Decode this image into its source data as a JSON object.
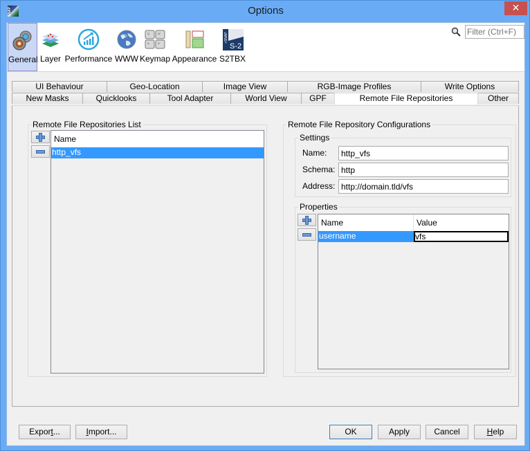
{
  "window": {
    "title": "Options",
    "app_icon_text": "SNAP",
    "close_glyph": "✕"
  },
  "toolbar": {
    "categories": [
      {
        "id": "general",
        "label": "General",
        "icon": "gears-icon",
        "selected": true
      },
      {
        "id": "layer",
        "label": "Layer",
        "icon": "layers-icon",
        "selected": false
      },
      {
        "id": "performance",
        "label": "Performance",
        "icon": "performance-chart-icon",
        "selected": false
      },
      {
        "id": "www",
        "label": "WWW",
        "icon": "globe-icon",
        "selected": false
      },
      {
        "id": "keymap",
        "label": "Keymap",
        "icon": "keyboard-keys-icon",
        "selected": false
      },
      {
        "id": "appearance",
        "label": "Appearance",
        "icon": "appearance-layout-icon",
        "selected": false
      },
      {
        "id": "s2tbx",
        "label": "S2TBX",
        "icon": "snap-s2-icon",
        "selected": false
      }
    ],
    "filter": {
      "placeholder": "Filter (Ctrl+F)",
      "value": ""
    }
  },
  "tabs": {
    "row_top": [
      {
        "label": "UI Behaviour"
      },
      {
        "label": "Geo-Location"
      },
      {
        "label": "Image View"
      },
      {
        "label": "RGB-Image Profiles"
      },
      {
        "label": "Write Options"
      }
    ],
    "row_bottom": [
      {
        "label": "New Masks"
      },
      {
        "label": "Quicklooks"
      },
      {
        "label": "Tool Adapter"
      },
      {
        "label": "World View"
      },
      {
        "label": "GPF"
      },
      {
        "label": "Remote File Repositories",
        "active": true
      },
      {
        "label": "Other"
      }
    ]
  },
  "repositories_list": {
    "title": "Remote File Repositories List",
    "add_label": "+",
    "remove_label": "−",
    "column_header": "Name",
    "rows": [
      {
        "name": "http_vfs",
        "selected": true
      }
    ]
  },
  "configurations": {
    "title": "Remote File Repository Configurations",
    "settings": {
      "title": "Settings",
      "fields": [
        {
          "label": "Name:",
          "value": "http_vfs"
        },
        {
          "label": "Schema:",
          "value": "http"
        },
        {
          "label": "Address:",
          "value": "http://domain.tld/vfs"
        }
      ]
    },
    "properties": {
      "title": "Properties",
      "columns": [
        "Name",
        "Value"
      ],
      "rows": [
        {
          "name": "username",
          "value": "vfs",
          "editing": true
        }
      ]
    }
  },
  "footer": {
    "export": {
      "label_pre": "Expor",
      "mnemonic": "t",
      "label_post": "..."
    },
    "import": {
      "label_pre": "",
      "mnemonic": "I",
      "label_post": "mport..."
    },
    "ok": "OK",
    "apply": "Apply",
    "cancel": "Cancel",
    "help": {
      "label_pre": "",
      "mnemonic": "H",
      "label_post": "elp"
    }
  },
  "colors": {
    "titlebar": "#6aabf5",
    "close": "#c75050",
    "selection": "#3399ff",
    "toolbar_selected": "#c9d8f5"
  }
}
